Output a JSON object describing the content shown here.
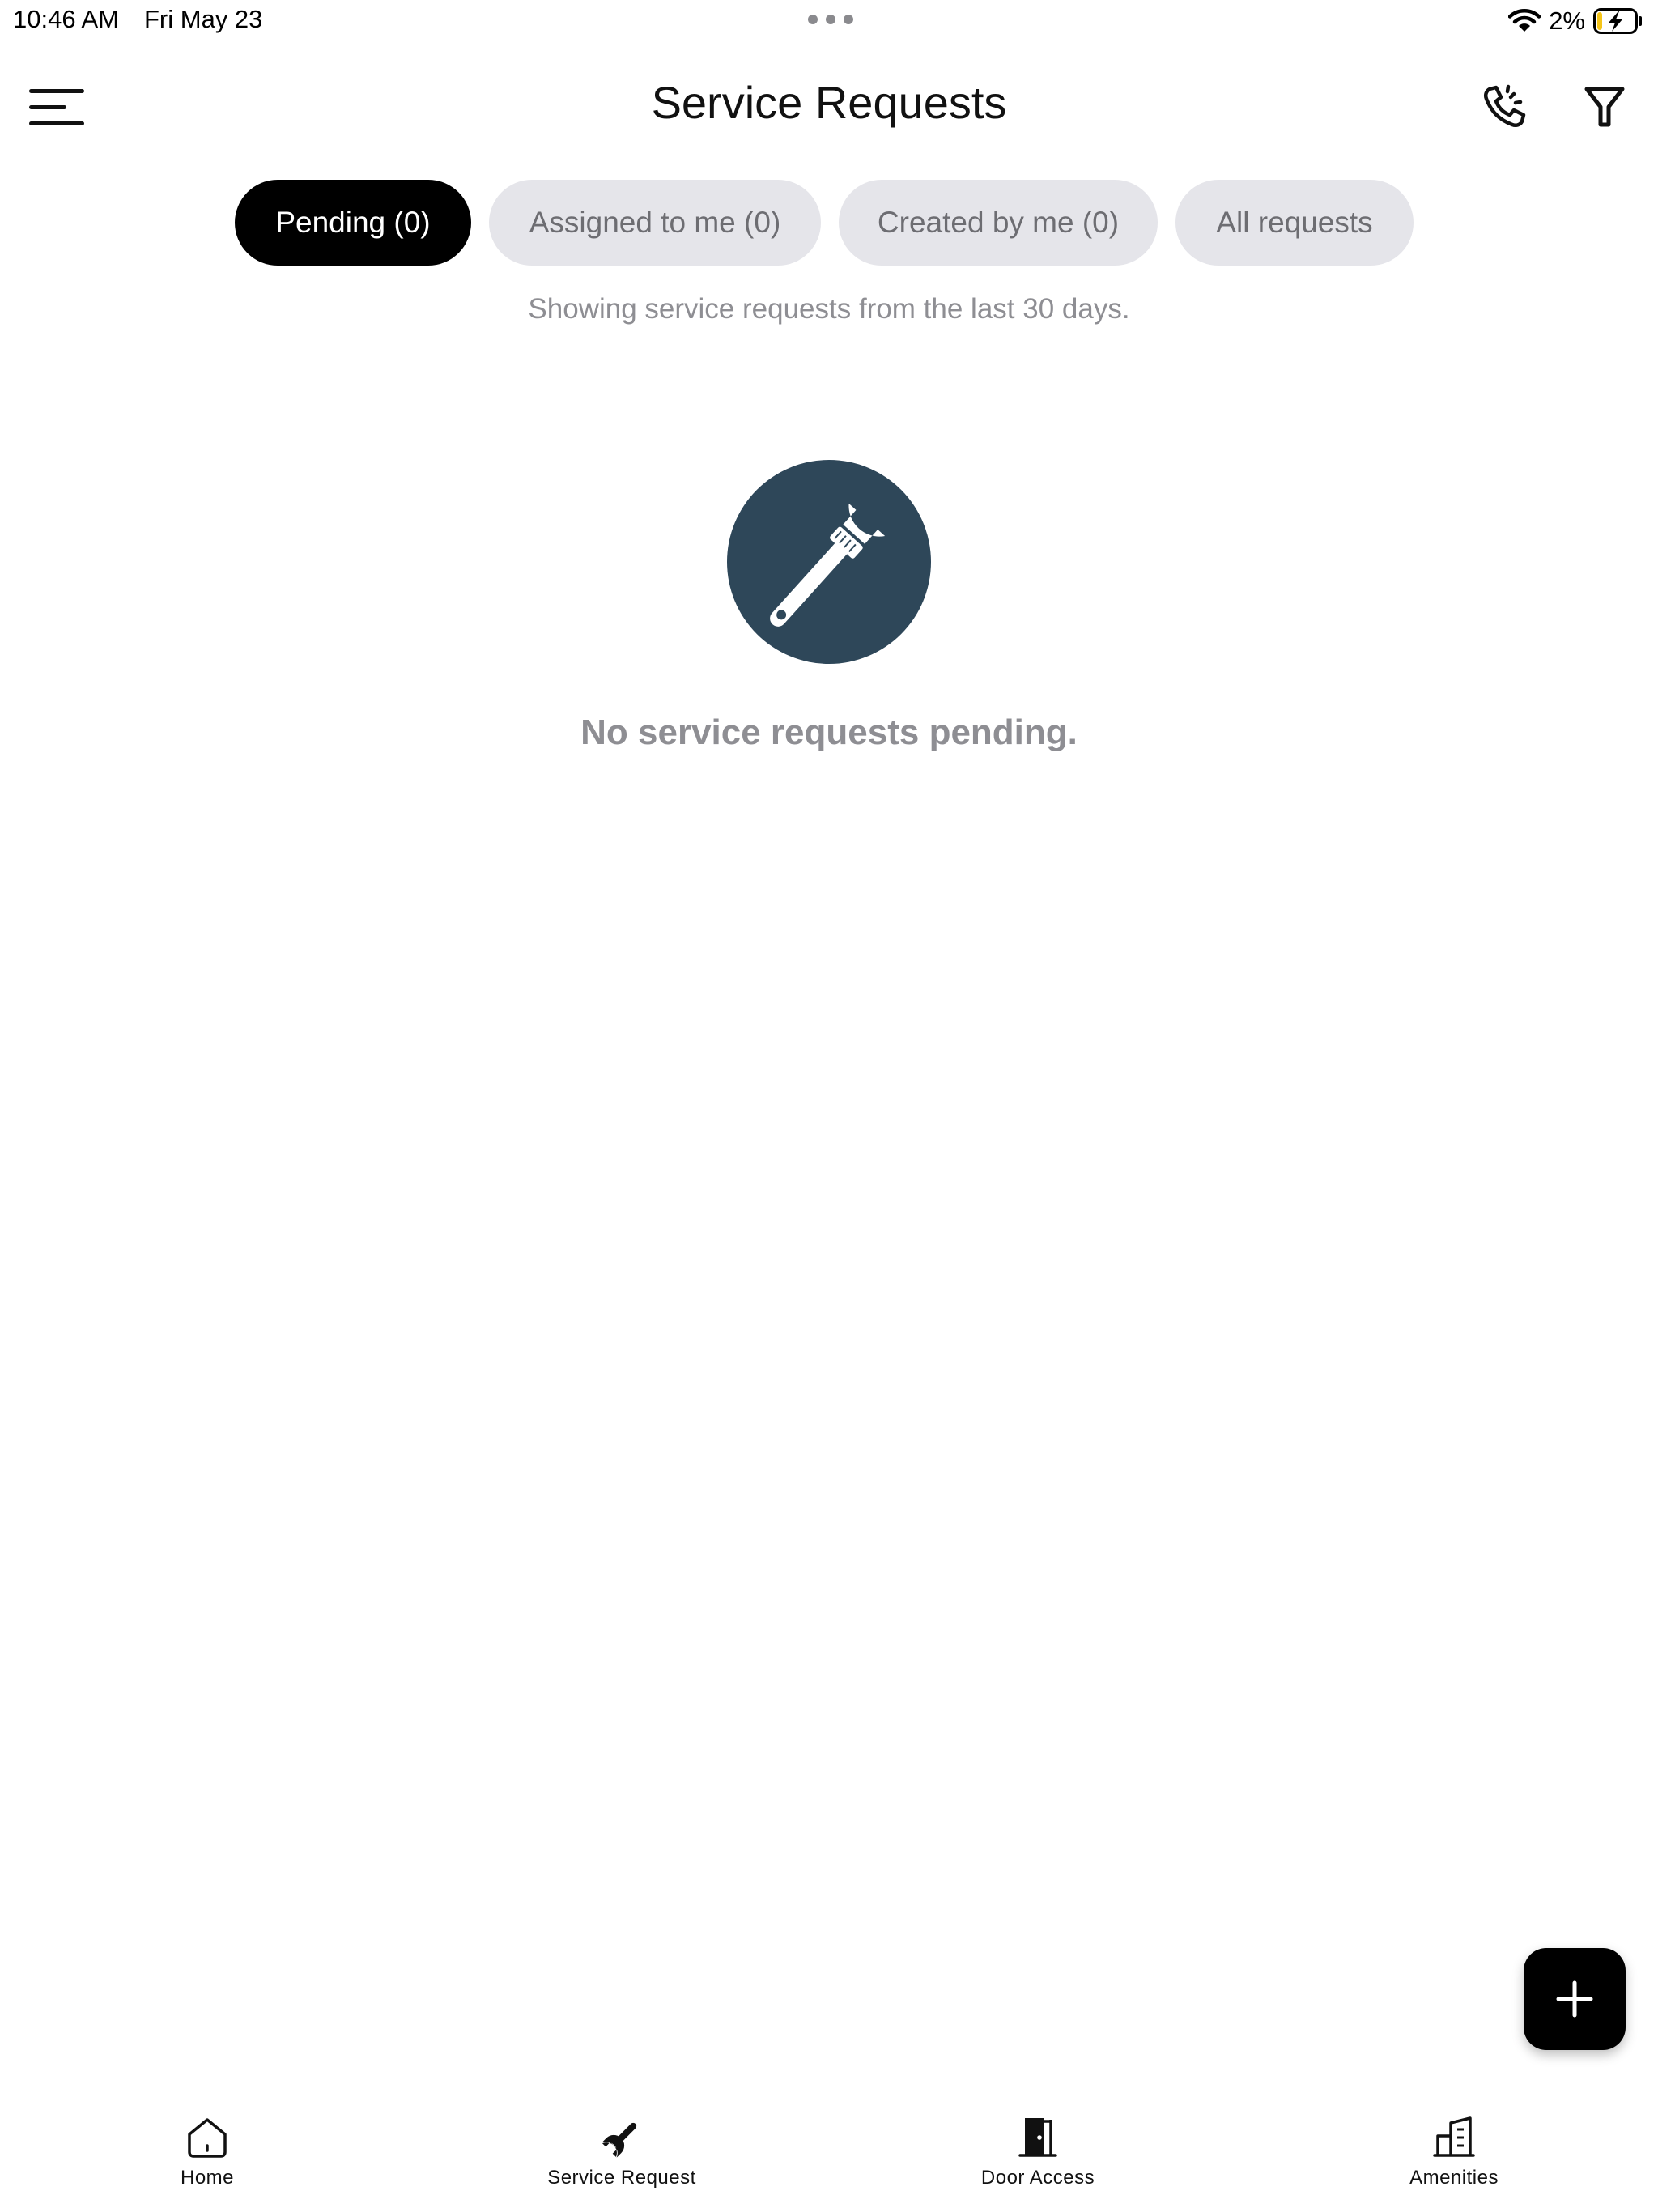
{
  "status_bar": {
    "time": "10:46 AM",
    "date": "Fri May 23",
    "battery_percent": "2%"
  },
  "header": {
    "title": "Service Requests"
  },
  "tabs": [
    {
      "label": "Pending (0)",
      "active": true
    },
    {
      "label": "Assigned to me (0)",
      "active": false
    },
    {
      "label": "Created by me (0)",
      "active": false
    },
    {
      "label": "All requests",
      "active": false
    }
  ],
  "subtitle": "Showing service requests from the last 30 days.",
  "empty_state": {
    "icon": "wrench-icon",
    "message": "No service requests pending."
  },
  "fab": {
    "icon": "plus-icon"
  },
  "bottom_nav": [
    {
      "label": "Home",
      "icon": "home-icon"
    },
    {
      "label": "Service Request",
      "icon": "wrench-icon"
    },
    {
      "label": "Door Access",
      "icon": "door-icon"
    },
    {
      "label": "Amenities",
      "icon": "building-icon"
    }
  ],
  "colors": {
    "active_tab": "#000000",
    "inactive_tab": "#e5e5ea",
    "empty_icon_bg": "#2e4759",
    "muted_text": "#8e8e93",
    "battery_charge": "#f5c518"
  }
}
